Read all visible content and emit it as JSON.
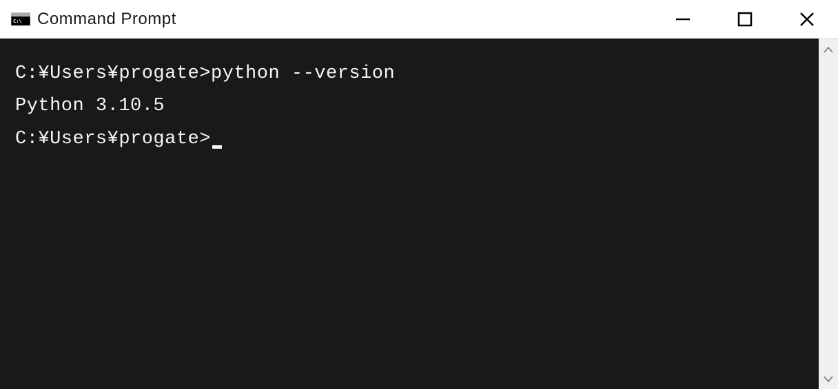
{
  "window": {
    "title": "Command Prompt"
  },
  "terminal": {
    "lines": [
      {
        "prompt": "C:¥Users¥progate>",
        "command": "python --version"
      },
      {
        "output": "Python 3.10.5"
      },
      {
        "prompt": "C:¥Users¥progate>",
        "cursor": true
      }
    ]
  }
}
